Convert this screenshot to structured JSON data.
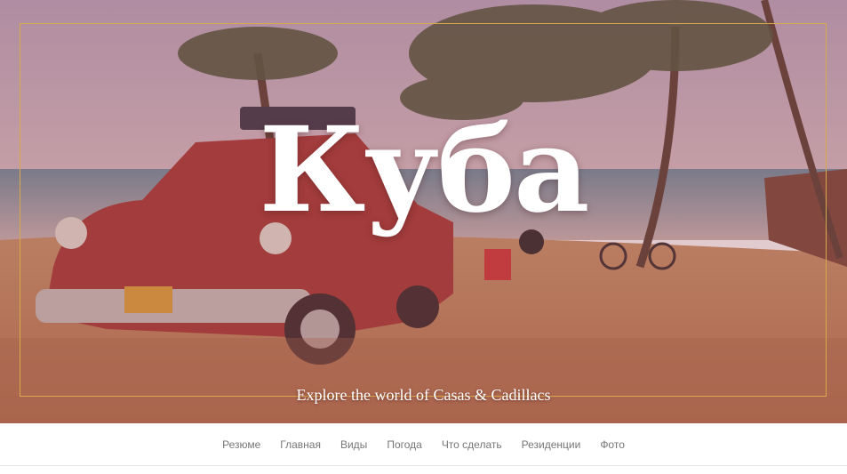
{
  "hero": {
    "title": "Куба",
    "subtitle": "Explore the world of Casas & Cadillacs",
    "image": "hero-photo-classic-car-beach-palms",
    "frame_color": "#d8a94a"
  },
  "nav": {
    "items": [
      {
        "label": "Резюме"
      },
      {
        "label": "Главная"
      },
      {
        "label": "Виды"
      },
      {
        "label": "Погода"
      },
      {
        "label": "Что сделать"
      },
      {
        "label": "Резиденции"
      },
      {
        "label": "Фото"
      }
    ]
  }
}
